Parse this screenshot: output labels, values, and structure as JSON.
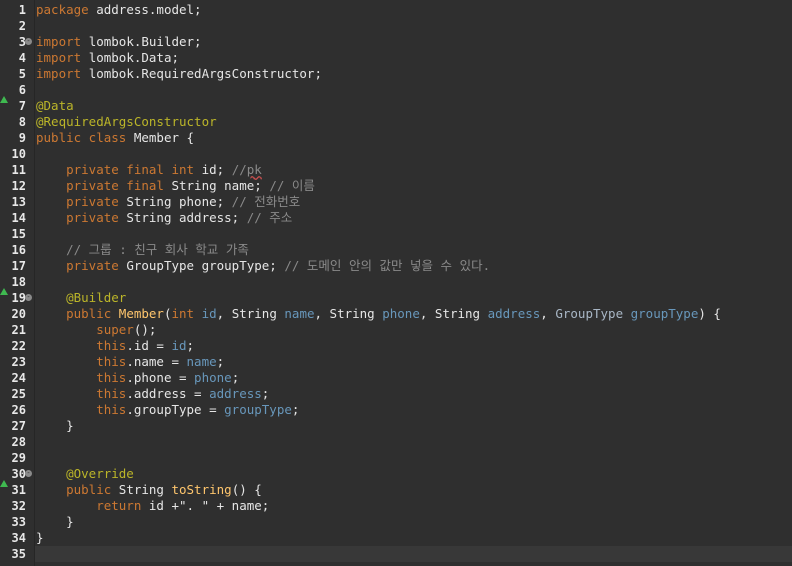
{
  "editor": {
    "colors": {
      "background": "#2f2f2f",
      "keyword": "#cc7832",
      "annotation": "#bbb529",
      "parameter": "#6897bb",
      "field": "#9876aa",
      "comment": "#8a8a8a",
      "marker": "#3fb950"
    },
    "lines": [
      {
        "number": "1",
        "tokens": [
          {
            "t": "package ",
            "c": "kw"
          },
          {
            "t": "address.model;",
            "c": "pl"
          }
        ]
      },
      {
        "number": "2",
        "tokens": []
      },
      {
        "number": "3",
        "fold": "-",
        "tokens": [
          {
            "t": "import ",
            "c": "kw"
          },
          {
            "t": "lombok.Builder;",
            "c": "pl"
          }
        ]
      },
      {
        "number": "4",
        "tokens": [
          {
            "t": "import ",
            "c": "kw"
          },
          {
            "t": "lombok.Data;",
            "c": "pl"
          }
        ]
      },
      {
        "number": "5",
        "tokens": [
          {
            "t": "import ",
            "c": "kw"
          },
          {
            "t": "lombok.RequiredArgsConstructor;",
            "c": "pl"
          }
        ]
      },
      {
        "number": "6",
        "tokens": []
      },
      {
        "number": "7",
        "marker": "up-triangle",
        "tokens": [
          {
            "t": "@Data",
            "c": "ann"
          }
        ]
      },
      {
        "number": "8",
        "tokens": [
          {
            "t": "@RequiredArgsConstructor",
            "c": "ann"
          }
        ]
      },
      {
        "number": "9",
        "tokens": [
          {
            "t": "public class ",
            "c": "kw"
          },
          {
            "t": "Member {",
            "c": "pl"
          }
        ]
      },
      {
        "number": "10",
        "tokens": []
      },
      {
        "number": "11",
        "tokens": [
          {
            "t": "    private final int ",
            "c": "kw"
          },
          {
            "t": "id; ",
            "c": "pl"
          },
          {
            "t": "//",
            "c": "cmt"
          },
          {
            "t": "pk",
            "c": "spell"
          }
        ]
      },
      {
        "number": "12",
        "tokens": [
          {
            "t": "    private final ",
            "c": "kw"
          },
          {
            "t": "String name; ",
            "c": "pl"
          },
          {
            "t": "// 이름",
            "c": "cmt"
          }
        ]
      },
      {
        "number": "13",
        "tokens": [
          {
            "t": "    private ",
            "c": "kw"
          },
          {
            "t": "String phone; ",
            "c": "pl"
          },
          {
            "t": "// 전화번호",
            "c": "cmt"
          }
        ]
      },
      {
        "number": "14",
        "tokens": [
          {
            "t": "    private ",
            "c": "kw"
          },
          {
            "t": "String address; ",
            "c": "pl"
          },
          {
            "t": "// 주소",
            "c": "cmt"
          }
        ]
      },
      {
        "number": "15",
        "tokens": []
      },
      {
        "number": "16",
        "tokens": [
          {
            "t": "    // 그룹 : 친구 회사 학교 가족",
            "c": "cmt"
          }
        ]
      },
      {
        "number": "17",
        "tokens": [
          {
            "t": "    private ",
            "c": "kw"
          },
          {
            "t": "GroupType groupType; ",
            "c": "pl"
          },
          {
            "t": "// 도메인 안의 값만 넣을 수 있다.",
            "c": "cmt"
          }
        ]
      },
      {
        "number": "18",
        "tokens": []
      },
      {
        "number": "19",
        "fold": "-",
        "marker": "up-triangle",
        "tokens": [
          {
            "t": "    @Builder",
            "c": "ann"
          }
        ]
      },
      {
        "number": "20",
        "tokens": [
          {
            "t": "    public ",
            "c": "kw"
          },
          {
            "t": "Member",
            "c": "method"
          },
          {
            "t": "(",
            "c": "pl"
          },
          {
            "t": "int ",
            "c": "kw"
          },
          {
            "t": "id",
            "c": "param"
          },
          {
            "t": ", String ",
            "c": "pl"
          },
          {
            "t": "name",
            "c": "param"
          },
          {
            "t": ", String ",
            "c": "pl"
          },
          {
            "t": "phone",
            "c": "param"
          },
          {
            "t": ", String ",
            "c": "pl"
          },
          {
            "t": "address",
            "c": "param"
          },
          {
            "t": ", ",
            "c": "pl"
          },
          {
            "t": "GroupType ",
            "c": "type"
          },
          {
            "t": "groupType",
            "c": "param"
          },
          {
            "t": ") {",
            "c": "pl"
          }
        ]
      },
      {
        "number": "21",
        "tokens": [
          {
            "t": "        super",
            "c": "kw"
          },
          {
            "t": "();",
            "c": "pl"
          }
        ]
      },
      {
        "number": "22",
        "tokens": [
          {
            "t": "        this",
            "c": "kw"
          },
          {
            "t": ".id = ",
            "c": "pl"
          },
          {
            "t": "id",
            "c": "param"
          },
          {
            "t": ";",
            "c": "pl"
          }
        ]
      },
      {
        "number": "23",
        "tokens": [
          {
            "t": "        this",
            "c": "kw"
          },
          {
            "t": ".name = ",
            "c": "pl"
          },
          {
            "t": "name",
            "c": "param"
          },
          {
            "t": ";",
            "c": "pl"
          }
        ]
      },
      {
        "number": "24",
        "tokens": [
          {
            "t": "        this",
            "c": "kw"
          },
          {
            "t": ".phone = ",
            "c": "pl"
          },
          {
            "t": "phone",
            "c": "param"
          },
          {
            "t": ";",
            "c": "pl"
          }
        ]
      },
      {
        "number": "25",
        "tokens": [
          {
            "t": "        this",
            "c": "kw"
          },
          {
            "t": ".address = ",
            "c": "pl"
          },
          {
            "t": "address",
            "c": "param"
          },
          {
            "t": ";",
            "c": "pl"
          }
        ]
      },
      {
        "number": "26",
        "tokens": [
          {
            "t": "        this",
            "c": "kw"
          },
          {
            "t": ".groupType = ",
            "c": "pl"
          },
          {
            "t": "groupType",
            "c": "param"
          },
          {
            "t": ";",
            "c": "pl"
          }
        ]
      },
      {
        "number": "27",
        "tokens": [
          {
            "t": "    }",
            "c": "pl"
          }
        ]
      },
      {
        "number": "28",
        "tokens": []
      },
      {
        "number": "29",
        "tokens": []
      },
      {
        "number": "30",
        "fold": "-",
        "tokens": [
          {
            "t": "    @Override",
            "c": "ann"
          }
        ]
      },
      {
        "number": "31",
        "marker": "up-triangle",
        "tokens": [
          {
            "t": "    public ",
            "c": "kw"
          },
          {
            "t": "String ",
            "c": "pl"
          },
          {
            "t": "toString",
            "c": "method"
          },
          {
            "t": "() {",
            "c": "pl"
          }
        ]
      },
      {
        "number": "32",
        "tokens": [
          {
            "t": "        return ",
            "c": "kw"
          },
          {
            "t": "id +\". \" + name;",
            "c": "pl"
          }
        ]
      },
      {
        "number": "33",
        "tokens": [
          {
            "t": "    }",
            "c": "pl"
          }
        ]
      },
      {
        "number": "34",
        "tokens": [
          {
            "t": "}",
            "c": "pl"
          }
        ]
      },
      {
        "number": "35",
        "current": true,
        "tokens": []
      }
    ]
  }
}
